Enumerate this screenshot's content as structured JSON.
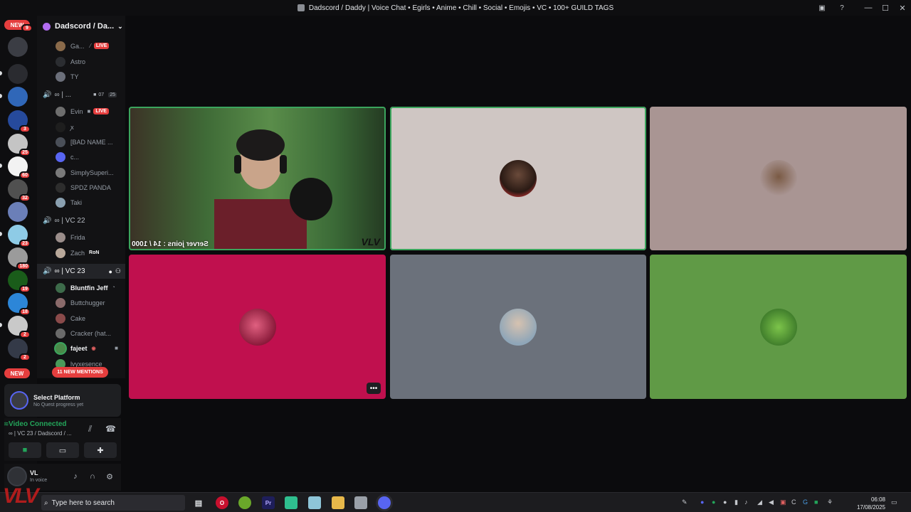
{
  "window": {
    "title": "Dadscord / Daddy | Voice Chat • Egirls • Anime • Chill • Social • Emojis • VC • 100+ GUILD TAGS"
  },
  "rail": {
    "new_top": "NEW",
    "new_bottom": "NEW",
    "badges": [
      "9",
      "3",
      "25",
      "60",
      "32",
      "23",
      "180",
      "19",
      "18",
      "2",
      "2"
    ]
  },
  "server": {
    "name": "Dadscord / Da..."
  },
  "channels": [
    {
      "kind": "user",
      "name": "Ga...",
      "live": "LIVE"
    },
    {
      "kind": "user",
      "name": "Astro"
    },
    {
      "kind": "user",
      "name": "TY"
    },
    {
      "kind": "voice",
      "name": "∞ | ...",
      "cam_count": "07",
      "limit": "25"
    },
    {
      "kind": "user",
      "name": "Evin",
      "live": "LIVE"
    },
    {
      "kind": "user",
      "name": "ꭗ"
    },
    {
      "kind": "user",
      "name": "[BAD NAME ..."
    },
    {
      "kind": "user",
      "name": "c..."
    },
    {
      "kind": "user",
      "name": "SimplySuperi..."
    },
    {
      "kind": "user",
      "name": "SPDZ PANDA"
    },
    {
      "kind": "user",
      "name": "Taki"
    },
    {
      "kind": "voice",
      "name": "∞ | VC 22"
    },
    {
      "kind": "user",
      "name": "Frida"
    },
    {
      "kind": "user",
      "name": "Zach",
      "tag": "RoN"
    },
    {
      "kind": "voice",
      "name": "∞ | VC 23",
      "selected": true
    },
    {
      "kind": "user",
      "name": "Bluntfin Jeff",
      "bright": true
    },
    {
      "kind": "user",
      "name": "Buttchugger"
    },
    {
      "kind": "user",
      "name": "Cake"
    },
    {
      "kind": "user",
      "name": "Cracker (hat..."
    },
    {
      "kind": "user",
      "name": "fajeet",
      "bright": true
    },
    {
      "kind": "user",
      "name": "lvyxesence"
    }
  ],
  "mentions": "11 NEW MENTIONS",
  "quest": {
    "title": "Select Platform",
    "subtitle": "No Quest progress yet"
  },
  "voice": {
    "status": "Video Connected",
    "location": "∞ | VC 23 / Dadscord / ..."
  },
  "user": {
    "name": "VL",
    "status": "In voice"
  },
  "stage": {
    "cam_overlay": "Server joins : 14 / 1000",
    "cam_logo": "VLV",
    "more_label": "•••"
  },
  "colors": {
    "tile2": "#cfc6c3",
    "tile3": "#a99593",
    "tile4": "#c0104e",
    "tile5": "#6b717b",
    "tile6": "#609a46",
    "speaking": "#3ba55d"
  },
  "taskbar": {
    "search_placeholder": "Type here to search",
    "time": "06:08",
    "date": "17/08/2025"
  },
  "brand": "VLV"
}
